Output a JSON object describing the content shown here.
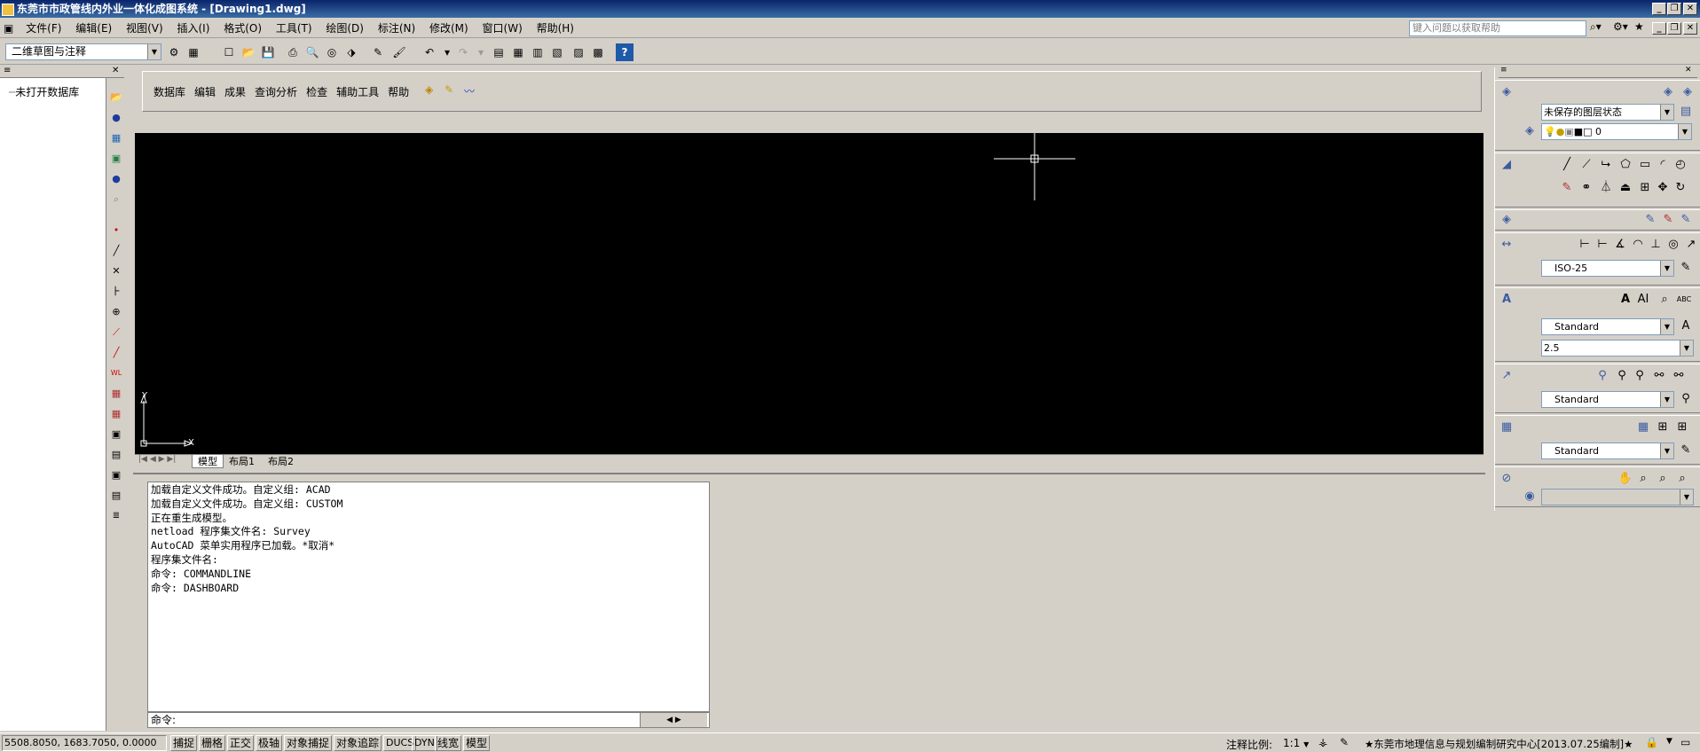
{
  "window": {
    "title": "东莞市市政管线内外业一体化成图系统 - [Drawing1.dwg]"
  },
  "menubar": {
    "items": [
      "文件(F)",
      "编辑(E)",
      "视图(V)",
      "插入(I)",
      "格式(O)",
      "工具(T)",
      "绘图(D)",
      "标注(N)",
      "修改(M)",
      "窗口(W)",
      "帮助(H)"
    ],
    "help_search_placeholder": "键入问题以获取帮助"
  },
  "toolbar": {
    "workspace": "二维草图与注释"
  },
  "left_panel": {
    "tree_item": "未打开数据库"
  },
  "survey_menu": {
    "items": [
      "数据库",
      "编辑",
      "成果",
      "查询分析",
      "检查",
      "辅助工具",
      "帮助"
    ]
  },
  "layout_tabs": [
    "模型",
    "布局1",
    "布局2"
  ],
  "command": {
    "history": [
      "加载自定义文件成功。自定义组: ACAD",
      "加载自定义文件成功。自定义组: CUSTOM",
      "正在重生成模型。",
      "netload 程序集文件名: Survey",
      "AutoCAD 菜单实用程序已加载。*取消*",
      "程序集文件名:",
      "命令: COMMANDLINE",
      "命令: DASHBOARD"
    ],
    "prompt": "命令:"
  },
  "right_panel": {
    "layer_state": "未保存的图层状态",
    "layer_current": "0",
    "dim_style": "ISO-25",
    "text_style": "Standard",
    "text_height": "2.5",
    "mleader_style": "Standard",
    "table_style": "Standard"
  },
  "ucs": {
    "x_label": "X",
    "y_label": "Y"
  },
  "statusbar": {
    "coordinates": "5508.8050, 1683.7050, 0.0000",
    "buttons": [
      "捕捉",
      "栅格",
      "正交",
      "极轴",
      "对象捕捉",
      "对象追踪",
      "DUCS",
      "DYN",
      "线宽",
      "模型"
    ],
    "annotation_scale_label": "注释比例:",
    "annotation_scale": "1:1",
    "credit": "★东莞市地理信息与规划编制研究中心[2013.07.25编制]★"
  }
}
